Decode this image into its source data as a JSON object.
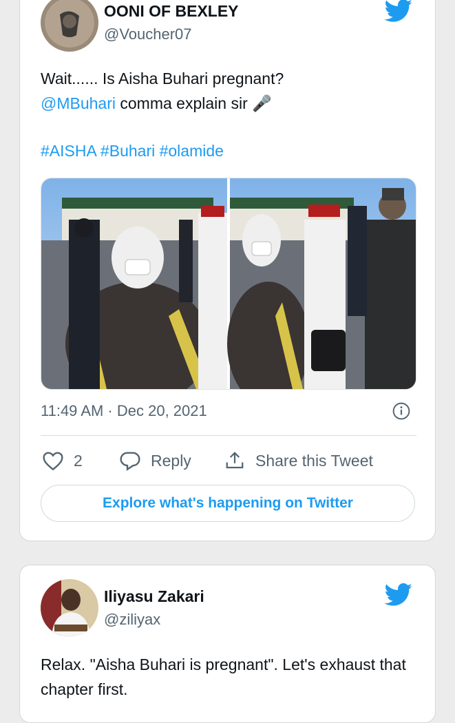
{
  "tweet1": {
    "display_name": "OONI OF BEXLEY",
    "handle": "@Voucher07",
    "text_line1": "Wait...... Is Aisha Buhari pregnant?",
    "mention": "@MBuhari",
    "text_line2_rest": " comma explain sir 🎤",
    "hashtags": "#AISHA #Buhari #olamide",
    "timestamp": "11:49 AM · Dec 20, 2021",
    "like_count": "2",
    "reply_label": "Reply",
    "share_label": "Share this Tweet",
    "explore_label": "Explore what's happening on Twitter"
  },
  "tweet2": {
    "display_name": "Iliyasu Zakari",
    "handle": "@ziliyax",
    "text": "Relax. \"Aisha Buhari is pregnant\". Let's exhaust that chapter first."
  },
  "colors": {
    "accent": "#1d9bf0",
    "muted": "#536471"
  }
}
